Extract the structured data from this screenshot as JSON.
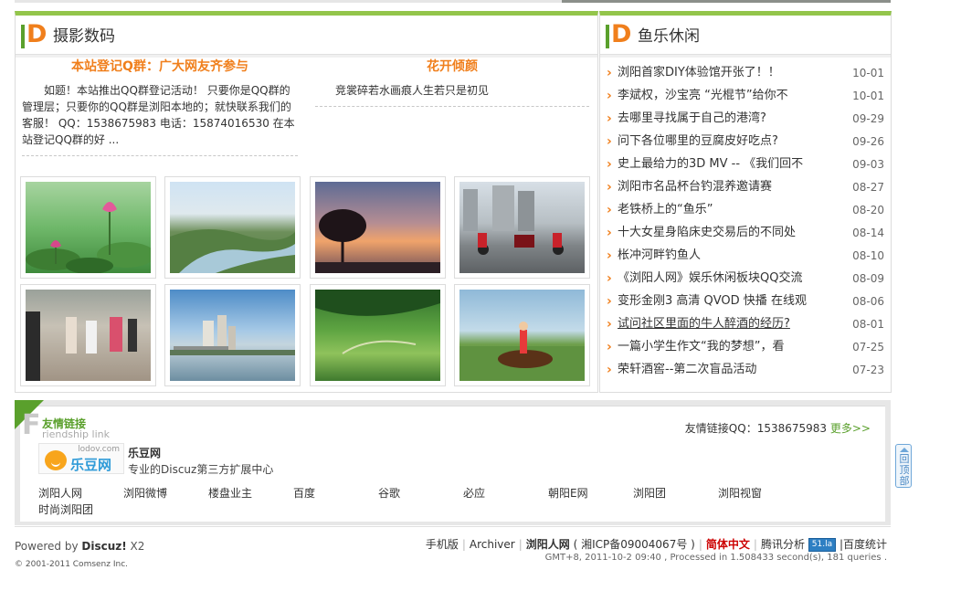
{
  "photo_section": {
    "title": "摄影数码",
    "notice_left": {
      "title": "本站登记Q群：广大网友齐参与",
      "body": "如题！本站推出QQ群登记活动！ 只要你是QQ群的管理层；只要你的QQ群是浏阳本地的；就快联系我们的客服！ QQ：1538675983 电话：15874016530 在本站登记QQ群的好 ..."
    },
    "notice_right": {
      "title": "花开倾颜",
      "body": "竞裳碎若水画痕人生若只是初见"
    },
    "thumbnails": [
      {
        "name": "lotus-pond"
      },
      {
        "name": "river-landscape"
      },
      {
        "name": "sunset-tree"
      },
      {
        "name": "street-motorcycles"
      },
      {
        "name": "girls-walking"
      },
      {
        "name": "city-river"
      },
      {
        "name": "green-valley"
      },
      {
        "name": "horse-rider"
      }
    ]
  },
  "leisure_section": {
    "title": "鱼乐休闲",
    "items": [
      {
        "title": "浏阳首家DIY体验馆开张了！！",
        "date": "10-01"
      },
      {
        "title": "李斌权，沙宝亮 “光棍节”给你不",
        "date": "10-01"
      },
      {
        "title": "去哪里寻找属于自己的港湾?",
        "date": "09-29"
      },
      {
        "title": "问下各位哪里的豆腐皮好吃点?",
        "date": "09-26"
      },
      {
        "title": "史上最给力的3D MV -- 《我们回不",
        "date": "09-03"
      },
      {
        "title": "浏阳市名品杯台钓混养邀请赛",
        "date": "08-27"
      },
      {
        "title": "老铁桥上的“鱼乐”",
        "date": "08-20"
      },
      {
        "title": "十大女星身陷床史交易后的不同处",
        "date": "08-14"
      },
      {
        "title": "枨冲河畔钓鱼人",
        "date": "08-10"
      },
      {
        "title": "《浏阳人网》娱乐休闲板块QQ交流",
        "date": "08-09"
      },
      {
        "title": "变形金刚3 高清 QVOD 快播 在线观",
        "date": "08-06"
      },
      {
        "title": "试问社区里面的牛人醉酒的经历?",
        "date": "08-01"
      },
      {
        "title": "一篇小学生作文“我的梦想”，看",
        "date": "07-25"
      },
      {
        "title": "荣轩酒窖--第二次盲品活动",
        "date": "07-23"
      }
    ]
  },
  "links_section": {
    "title": "友情链接",
    "subtitle": "riendship link",
    "qq_label": "友情链接QQ：1538675983",
    "more": "更多>>",
    "featured": {
      "logo_domain": "lodov.com",
      "logo_name": "乐豆网",
      "title": "乐豆网",
      "desc": "专业的Discuz第三方扩展中心"
    },
    "links": [
      "浏阳人网",
      "浏阳微博",
      "楼盘业主",
      "百度",
      "谷歌",
      "必应",
      "朝阳E网",
      "浏阳团",
      "浏阳视窗",
      "时尚浏阳团"
    ]
  },
  "footer": {
    "powered_prefix": "Powered by ",
    "powered_brand": "Discuz!",
    "powered_version": " X2",
    "copyright": "© 2001-2011 Comsenz Inc.",
    "links": {
      "mobile": "手机版",
      "archiver": "Archiver",
      "site_name": "浏阳人网",
      "icp": "湘ICP备09004067号",
      "simplified": "简体中文",
      "tencent": "腾讯分析",
      "badge": "51.la",
      "baidu": "|百度统计"
    },
    "gmt": "GMT+8, 2011-10-2 09:40 , Processed in 1.508433 second(s), 181 queries ."
  },
  "backtop": {
    "label": "回顶部"
  },
  "colors": {
    "accent_green": "#93c54b",
    "accent_orange": "#f07f1c"
  }
}
